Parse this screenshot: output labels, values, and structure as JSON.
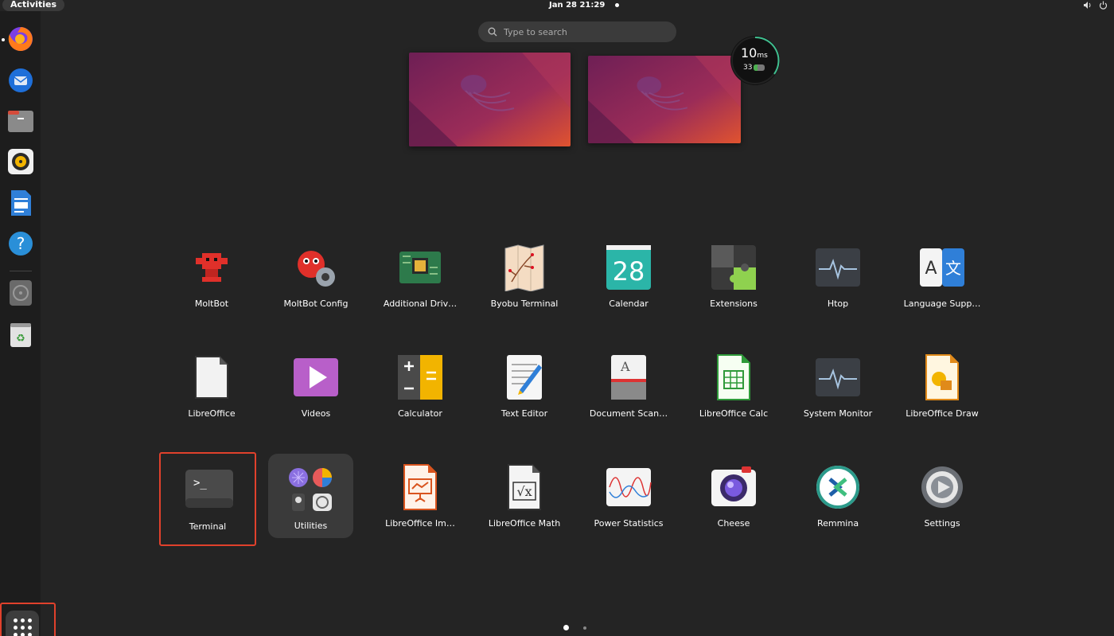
{
  "topbar": {
    "activities_label": "Activities",
    "clock": "Jan 28  21:29",
    "tray_volume_icon": "volume-icon",
    "tray_power_icon": "power-icon"
  },
  "search": {
    "placeholder": "Type to search"
  },
  "latency_widget": {
    "value": "10",
    "unit": "ms",
    "battery_percent": "33",
    "battery_level": 0.33
  },
  "dock": {
    "items": [
      {
        "name": "Firefox",
        "icon": "firefox-icon",
        "running": true
      },
      {
        "name": "Thunderbird",
        "icon": "thunderbird-icon"
      },
      {
        "name": "Files",
        "icon": "files-icon"
      },
      {
        "name": "Rhythmbox",
        "icon": "rhythmbox-icon"
      },
      {
        "name": "LibreOffice Writer",
        "icon": "writer-icon"
      },
      {
        "name": "Help",
        "icon": "help-icon"
      },
      {
        "name": "Disk",
        "icon": "disk-icon"
      },
      {
        "name": "Trash",
        "icon": "trash-icon"
      }
    ],
    "show_apps_icon": "grid-icon"
  },
  "apps": [
    {
      "label": "MoltBot",
      "icon": "moltbot-icon"
    },
    {
      "label": "MoltBot Config",
      "icon": "moltbot-config-icon"
    },
    {
      "label": "Additional Driv…",
      "icon": "chip-icon"
    },
    {
      "label": "Byobu Terminal",
      "icon": "byobu-icon"
    },
    {
      "label": "Calendar",
      "icon": "calendar-icon",
      "day": "28"
    },
    {
      "label": "Extensions",
      "icon": "puzzle-icon"
    },
    {
      "label": "Htop",
      "icon": "htop-icon"
    },
    {
      "label": "Language Supp…",
      "icon": "language-icon",
      "glyph_a": "A",
      "glyph_b": "文"
    },
    {
      "label": "LibreOffice",
      "icon": "libreoffice-icon"
    },
    {
      "label": "Videos",
      "icon": "videos-icon"
    },
    {
      "label": "Calculator",
      "icon": "calculator-icon"
    },
    {
      "label": "Text Editor",
      "icon": "text-editor-icon"
    },
    {
      "label": "Document Scan…",
      "icon": "scanner-icon",
      "glyph": "A"
    },
    {
      "label": "LibreOffice Calc",
      "icon": "calc-icon"
    },
    {
      "label": "System Monitor",
      "icon": "system-monitor-icon"
    },
    {
      "label": "LibreOffice Draw",
      "icon": "draw-icon"
    },
    {
      "label": "Terminal",
      "icon": "terminal-icon",
      "glyph": ">_",
      "selected": true
    },
    {
      "label": "Utilities",
      "icon": "folder-icon",
      "folder": true
    },
    {
      "label": "LibreOffice Im…",
      "icon": "impress-icon"
    },
    {
      "label": "LibreOffice Math",
      "icon": "math-icon",
      "glyph": "√x"
    },
    {
      "label": "Power Statistics",
      "icon": "power-stats-icon"
    },
    {
      "label": "Cheese",
      "icon": "cheese-icon"
    },
    {
      "label": "Remmina",
      "icon": "remmina-icon"
    },
    {
      "label": "Settings",
      "icon": "settings-icon"
    }
  ],
  "pager": {
    "pages": 2,
    "current": 1
  },
  "colors": {
    "accent": "#e0412c",
    "background": "#242424",
    "dock": "#1d1d1d"
  }
}
